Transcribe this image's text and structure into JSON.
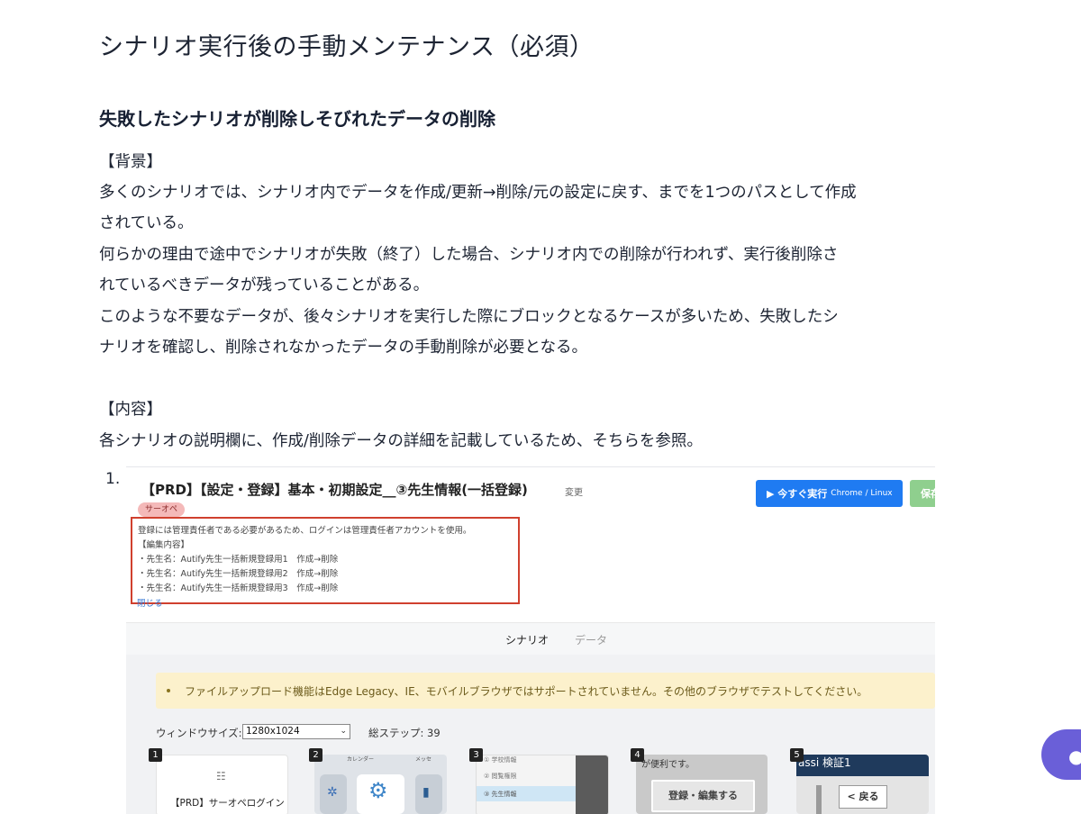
{
  "article": {
    "title": "シナリオ実行後の手動メンテナンス（必須）",
    "section_title": "失敗したシナリオが削除しそびれたデータの削除",
    "background_heading": "【背景】",
    "background_lines": [
      "多くのシナリオでは、シナリオ内でデータを作成/更新→削除/元の設定に戻す、までを1つのパスとして作成",
      "されている。",
      "何らかの理由で途中でシナリオが失敗（終了）した場合、シナリオ内での削除が行われず、実行後削除さ",
      "れているべきデータが残っていることがある。",
      "このような不要なデータが、後々シナリオを実行した際にブロックとなるケースが多いため、失敗したシ",
      "ナリオを確認し、削除されなかったデータの手動削除が必要となる。"
    ],
    "content_heading": "【内容】",
    "content_line": "各シナリオの説明欄に、作成/削除データの詳細を記載しているため、そちらを参照。",
    "list_number": "1."
  },
  "screenshot": {
    "scenario_title": "【PRD】【設定・登録】基本・初期設定__③先生情報(一括登録)",
    "change_link": "変更",
    "run_button": "▶ 今すぐ実行",
    "run_button_sub": "Chrome / Linux",
    "save_button": "保存",
    "tag": "サーオペ",
    "description": [
      "登録には管理責任者である必要があるため、ログインは管理責任者アカウントを使用。",
      "【編集内容】",
      "・先生名：Autify先生一括新規登録用1　作成→削除",
      "・先生名：Autify先生一括新規登録用2　作成→削除",
      "・先生名：Autify先生一括新規登録用3　作成→削除"
    ],
    "close_link": "閉じる",
    "tabs": [
      "シナリオ",
      "データ"
    ],
    "alert": "ファイルアップロード機能はEdge Legacy、IE、モバイルブラウザではサポートされていません。その他のブラウザでテストしてください。",
    "window_size_label": "ウィンドウサイズ:",
    "window_size_value": "1280x1024",
    "total_steps_label": "総ステップ: 39",
    "steps": [
      {
        "num": "1",
        "text": "【PRD】サーオペログイン"
      },
      {
        "num": "2",
        "text": "カレンダー"
      },
      {
        "num": "3",
        "text": "先生情報"
      },
      {
        "num": "4",
        "text": "が便利です。",
        "button": "登録・編集する"
      },
      {
        "num": "5",
        "text": "assi 検証1",
        "button": "< 戻る"
      }
    ],
    "step2_labels": [
      "カレンダー",
      "メッセ"
    ],
    "step3_menu": [
      "① 学校情報",
      "② 閲覧権限",
      "③ 先生情報"
    ]
  },
  "colors": {
    "run_button": "#1f7bf2",
    "save_button": "#8fcf8e",
    "highlight_box": "#d0402e",
    "alert_bg": "#fcf1cc",
    "chat_bubble": "#6a5fd8"
  }
}
